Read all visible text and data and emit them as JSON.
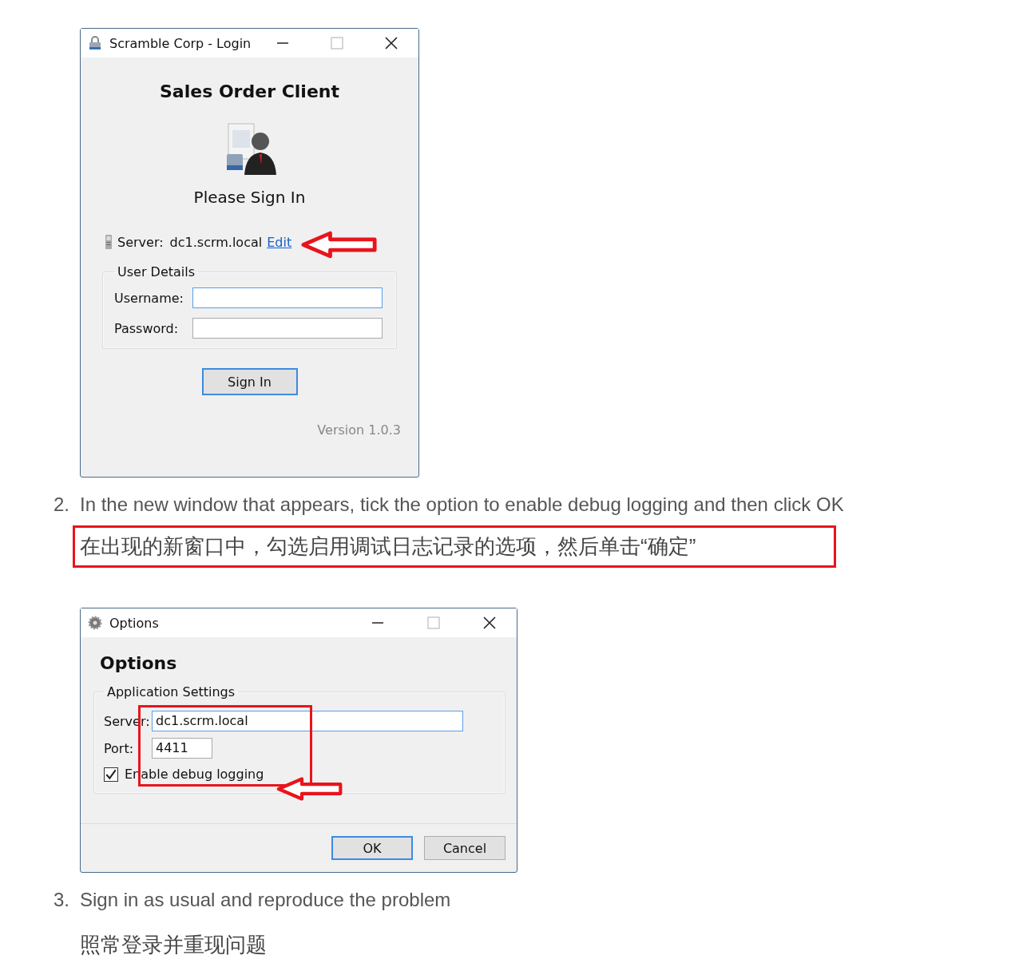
{
  "blocks": [
    {
      "kind": "login_window",
      "title": "Scramble Corp - Login",
      "heading": "Sales Order Client",
      "prompt": "Please Sign In",
      "server_label": "Server:",
      "server_value": "dc1.scrm.local",
      "edit_link": "Edit",
      "group_title": "User Details",
      "fields": [
        {
          "label": "Username:",
          "focused": true
        },
        {
          "label": "Password:",
          "focused": false
        }
      ],
      "sign_in_button": "Sign In",
      "version": "Version 1.0.3"
    },
    {
      "kind": "step",
      "number": "2.",
      "text": "In the new window that appears, tick the option to enable debug logging and then click OK",
      "translation": "在出现的新窗口中，勾选启用调试日志记录的选项，然后单击“确定”",
      "highlighted": true
    },
    {
      "kind": "options_window",
      "title": "Options",
      "heading": "Options",
      "group_title": "Application Settings",
      "fields": [
        {
          "label": "Server:",
          "value": "dc1.scrm.local",
          "focused": true
        },
        {
          "label": "Port:",
          "value": "4411",
          "focused": false
        }
      ],
      "checkbox": {
        "label": "Enable debug logging",
        "checked": true
      },
      "buttons": [
        {
          "label": "OK",
          "default": true
        },
        {
          "label": "Cancel",
          "default": false
        }
      ]
    },
    {
      "kind": "step",
      "number": "3.",
      "text": "Sign in as usual and reproduce the problem",
      "translation": "照常登录并重现问题",
      "highlighted": false
    }
  ]
}
